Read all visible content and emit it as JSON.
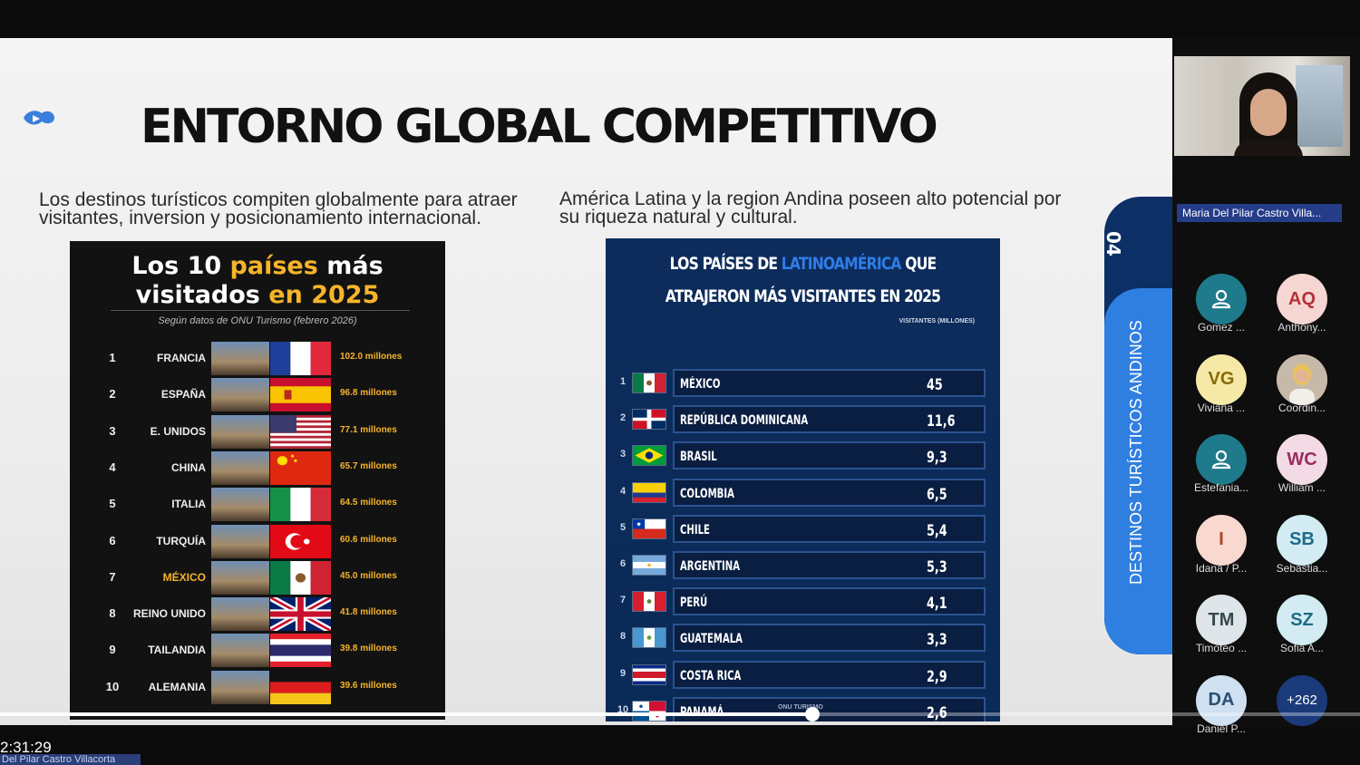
{
  "slide": {
    "title": "ENTORNO GLOBAL COMPETITIVO",
    "left_text": "Los destinos turísticos compiten globalmente para atraer visitantes, inversion y posicionamiento internacional.",
    "right_text": "América Latina y la region Andina poseen alto potencial por su riqueza natural y cultural.",
    "side_number": "04",
    "side_label": "DESTINOS TURÍSTICOS ANDINOS"
  },
  "info_left": {
    "title_a": "Los 10 ",
    "title_b": "países",
    "title_c": " más",
    "title_d": "visitados ",
    "title_e": "en 2025",
    "subtitle": "Según datos de ONU Turismo (febrero 2026)",
    "rows": [
      {
        "rank": "1",
        "name": "FRANCIA",
        "value": "102.0 millones",
        "flag": "fr"
      },
      {
        "rank": "2",
        "name": "ESPAÑA",
        "value": "96.8 millones",
        "flag": "es"
      },
      {
        "rank": "3",
        "name": "E. UNIDOS",
        "value": "77.1 millones",
        "flag": "us"
      },
      {
        "rank": "4",
        "name": "CHINA",
        "value": "65.7 millones",
        "flag": "cn"
      },
      {
        "rank": "5",
        "name": "ITALIA",
        "value": "64.5 millones",
        "flag": "it"
      },
      {
        "rank": "6",
        "name": "TURQUÍA",
        "value": "60.6 millones",
        "flag": "tr"
      },
      {
        "rank": "7",
        "name": "MÉXICO",
        "value": "45.0 millones",
        "flag": "mx"
      },
      {
        "rank": "8",
        "name": "REINO UNIDO",
        "value": "41.8 millones",
        "flag": "gb"
      },
      {
        "rank": "9",
        "name": "TAILANDIA",
        "value": "39.8 millones",
        "flag": "th"
      },
      {
        "rank": "10",
        "name": "ALEMANIA",
        "value": "39.6 millones",
        "flag": "de"
      }
    ]
  },
  "info_right": {
    "title_a": "LOS PAÍSES DE ",
    "title_b": "LATINOAMÉRICA",
    "title_c": " QUE",
    "title_d": "ATRAJERON MÁS VISITANTES EN 2025",
    "column_header": "VISITANTES (MILLONES)",
    "source": "ONU TURISMO",
    "rows": [
      {
        "rank": "1",
        "name": "MÉXICO",
        "value": "45",
        "flag": "mx"
      },
      {
        "rank": "2",
        "name": "REPÚBLICA DOMINICANA",
        "value": "11,6",
        "flag": "do"
      },
      {
        "rank": "3",
        "name": "BRASIL",
        "value": "9,3",
        "flag": "br"
      },
      {
        "rank": "4",
        "name": "COLOMBIA",
        "value": "6,5",
        "flag": "co"
      },
      {
        "rank": "5",
        "name": "CHILE",
        "value": "5,4",
        "flag": "cl"
      },
      {
        "rank": "6",
        "name": "ARGENTINA",
        "value": "5,3",
        "flag": "ar"
      },
      {
        "rank": "7",
        "name": "PERÚ",
        "value": "4,1",
        "flag": "pe"
      },
      {
        "rank": "8",
        "name": "GUATEMALA",
        "value": "3,3",
        "flag": "gt"
      },
      {
        "rank": "9",
        "name": "COSTA RICA",
        "value": "2,9",
        "flag": "cr"
      },
      {
        "rank": "10",
        "name": "PANAMÁ",
        "value": "2,6",
        "flag": "pa"
      }
    ]
  },
  "meeting": {
    "presenter_name": "Maria Del Pilar Castro Villa...",
    "participants": [
      {
        "initials": "",
        "name": "Gomez ...",
        "bg": "#1f7a8c",
        "fg": "#ffffff",
        "icon": "user-icon"
      },
      {
        "initials": "AQ",
        "name": "Anthony...",
        "bg": "#f6d6d2",
        "fg": "#b2323a"
      },
      {
        "initials": "VG",
        "name": "Viviana ...",
        "bg": "#f6e9a8",
        "fg": "#8a6a00"
      },
      {
        "initials": "",
        "name": "Coordin...",
        "bg": "#c9a98f",
        "fg": "#ffffff",
        "icon": "photo-avatar"
      },
      {
        "initials": "",
        "name": "Estefania...",
        "bg": "#1f7a8c",
        "fg": "#ffffff",
        "icon": "user-icon"
      },
      {
        "initials": "WC",
        "name": "William ...",
        "bg": "#f3dbe6",
        "fg": "#9a2c5e"
      },
      {
        "initials": "I",
        "name": "Idana / P...",
        "bg": "#f9d8cf",
        "fg": "#b2452a"
      },
      {
        "initials": "SB",
        "name": "Sebastia...",
        "bg": "#d3ecf4",
        "fg": "#1e6b85"
      },
      {
        "initials": "TM",
        "name": "Timoteo ...",
        "bg": "#dfe6ea",
        "fg": "#37474f"
      },
      {
        "initials": "SZ",
        "name": "Sofia A...",
        "bg": "#d3ecf4",
        "fg": "#1e6b85"
      },
      {
        "initials": "DA",
        "name": "Daniel P...",
        "bg": "#cfe0f0",
        "fg": "#2b4f75"
      },
      {
        "initials": "+262",
        "name": "",
        "bg": "#1a3a7a",
        "fg": "#ffffff"
      }
    ]
  },
  "player": {
    "time": "2:31:29",
    "presenter_strip": "Del Pilar Castro Villacorta",
    "progress_fraction": 0.597
  }
}
